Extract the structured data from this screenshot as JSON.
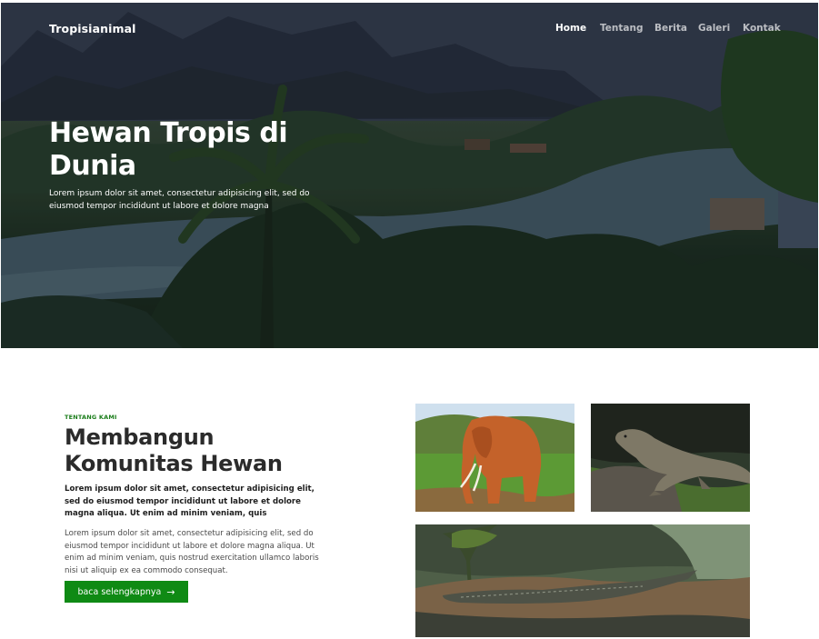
{
  "site": {
    "brand": "Tropisianimal"
  },
  "nav": {
    "items": [
      {
        "label": "Home",
        "active": true
      },
      {
        "label": "Tentang",
        "active": false
      },
      {
        "label": "Berita",
        "active": false
      },
      {
        "label": "Galeri",
        "active": false
      },
      {
        "label": "Kontak",
        "active": false
      }
    ]
  },
  "hero": {
    "title": "Hewan Tropis di Dunia",
    "subtitle": "Lorem ipsum dolor sit amet, consectetur adipisicing elit, sed do eiusmod tempor incididunt ut labore et dolore magna"
  },
  "about": {
    "eyebrow": "TENTANG KAMI",
    "title": "Membangun Komunitas Hewan",
    "lead": "Lorem ipsum dolor sit amet, consectetur adipisicing elit, sed do eiusmod tempor incididunt ut labore et dolore magna aliqua. Ut enim ad minim veniam, quis",
    "body": "Lorem ipsum dolor sit amet, consectetur adipisicing elit, sed do eiusmod tempor incididunt ut labore et dolore magna aliqua. Ut enim ad minim veniam, quis nostrud exercitation ullamco laboris nisi ut aliquip ex ea commodo consequat.",
    "cta_label": "baca selengkapnya",
    "cta_icon": "arrow-right-icon"
  },
  "gallery": {
    "images": [
      "elephant-photo",
      "komodo-photo",
      "crocodile-photo"
    ]
  },
  "colors": {
    "accent_green": "#0f8a14",
    "eyebrow_green": "#1a7d1a",
    "top_border": "#d8d36a"
  }
}
